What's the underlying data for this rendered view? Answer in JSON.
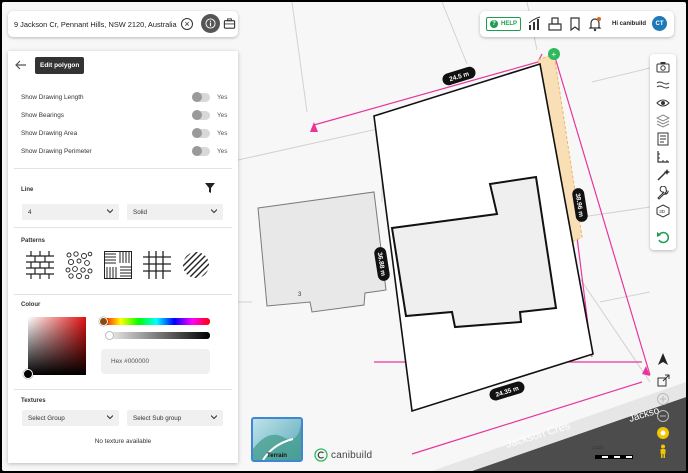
{
  "search": {
    "value": "9 Jackson Cr, Pennant Hills, NSW 2120, Australia"
  },
  "topbar": {
    "help_label": "HELP",
    "greeting": "Hi canibuild",
    "avatar_initials": "CT"
  },
  "panel": {
    "edit_polygon_label": "Edit polygon",
    "toggles": [
      {
        "label": "Show Drawing Length",
        "value": "Yes"
      },
      {
        "label": "Show Bearings",
        "value": "Yes"
      },
      {
        "label": "Show Drawing Area",
        "value": "Yes"
      },
      {
        "label": "Show Drawing Perimeter",
        "value": "Yes"
      }
    ],
    "line": {
      "title": "Line",
      "width_value": "4",
      "style_value": "Solid"
    },
    "patterns": {
      "title": "Patterns",
      "items": [
        "brick",
        "gravel",
        "parquet",
        "grid",
        "diagonal"
      ]
    },
    "colour": {
      "title": "Colour",
      "hex_label": "Hex #000000"
    },
    "textures": {
      "title": "Textures",
      "group_placeholder": "Select Group",
      "subgroup_placeholder": "Select Sub group",
      "empty_message": "No texture available"
    }
  },
  "map": {
    "dimensions": [
      "24.5 m",
      "38.96 m",
      "36.88 m",
      "24.35 m"
    ],
    "lot_number": "3",
    "street_labels": [
      "Jackson Cres",
      "Jackso"
    ],
    "scale_label": "1:220"
  },
  "bottom": {
    "terrain_label": "Terrain",
    "brand": "canibuild"
  },
  "colors": {
    "boundary": "#e8359b",
    "highlight": "#f4c27a",
    "accent_green": "#1e9c4f",
    "avatar": "#1f79b8",
    "road": "#4c4c4c"
  }
}
